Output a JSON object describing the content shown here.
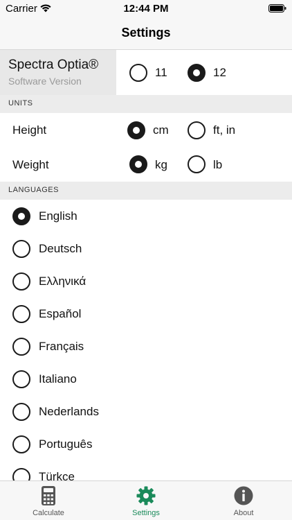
{
  "status_bar": {
    "carrier": "Carrier",
    "time": "12:44 PM"
  },
  "nav": {
    "title": "Settings"
  },
  "product": {
    "name": "Spectra Optia®",
    "subtitle": "Software Version",
    "versions": [
      {
        "label": "11",
        "checked": false
      },
      {
        "label": "12",
        "checked": true
      }
    ]
  },
  "units": {
    "header": "UNITS",
    "height": {
      "label": "Height",
      "options": [
        {
          "label": "cm",
          "checked": true
        },
        {
          "label": "ft, in",
          "checked": false
        }
      ]
    },
    "weight": {
      "label": "Weight",
      "options": [
        {
          "label": "kg",
          "checked": true
        },
        {
          "label": "lb",
          "checked": false
        }
      ]
    }
  },
  "languages": {
    "header": "LANGUAGES",
    "items": [
      {
        "label": "English",
        "checked": true
      },
      {
        "label": "Deutsch",
        "checked": false
      },
      {
        "label": "Ελληνικά",
        "checked": false
      },
      {
        "label": "Español",
        "checked": false
      },
      {
        "label": "Français",
        "checked": false
      },
      {
        "label": "Italiano",
        "checked": false
      },
      {
        "label": "Nederlands",
        "checked": false
      },
      {
        "label": "Português",
        "checked": false
      },
      {
        "label": "Türkçe",
        "checked": false
      }
    ]
  },
  "tabs": [
    {
      "label": "Calculate",
      "icon": "calculator-icon",
      "active": false
    },
    {
      "label": "Settings",
      "icon": "gear-icon",
      "active": true
    },
    {
      "label": "About",
      "icon": "info-icon",
      "active": false
    }
  ],
  "colors": {
    "accent": "#1a8a5a",
    "radio": "#1a1a1a",
    "inactive_tab": "#555555"
  }
}
